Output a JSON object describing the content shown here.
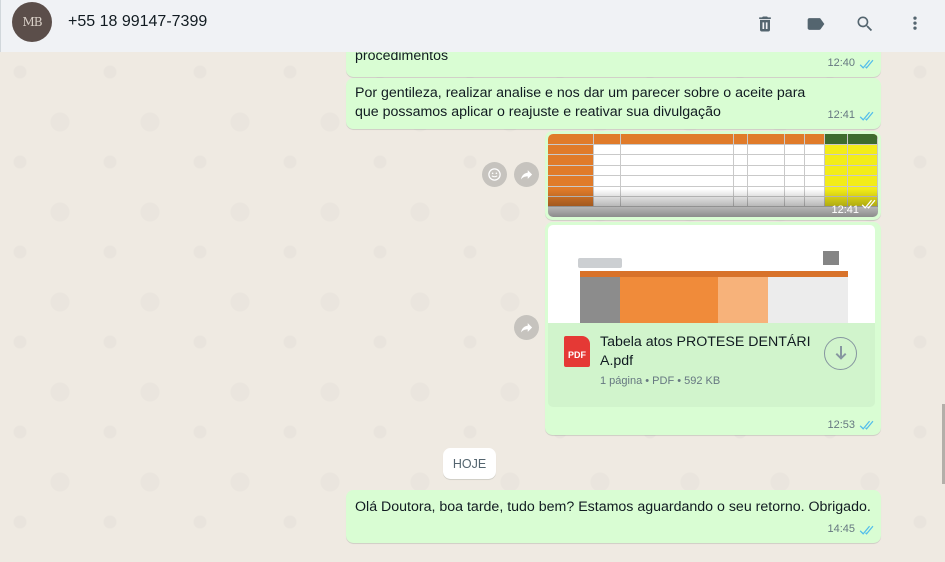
{
  "header": {
    "avatar_initials": "MB",
    "contact": "+55 18 99147-7399",
    "icons": [
      "trash-icon",
      "label-icon",
      "search-icon",
      "menu-dots-icon"
    ]
  },
  "messages": [
    {
      "text": "procedimentos",
      "time": "12:40"
    },
    {
      "text": "Por gentileza, realizar analise e nos dar um parecer sobre o aceite para que possamos aplicar o reajuste e reativar sua divulgação",
      "time": "12:41"
    },
    {
      "type": "image",
      "time": "12:41"
    },
    {
      "type": "document",
      "file_name": "Tabela atos PROTESE DENTÁRIA.pdf",
      "info": "1 página • PDF • 592 KB",
      "icon_label": "PDF",
      "time": "12:53"
    },
    {
      "text": "Olá Doutora, boa tarde, tudo bem? Estamos aguardando o seu retorno. Obrigado.",
      "time": "14:45"
    }
  ],
  "date_chip": "HOJE",
  "colors": {
    "bubble": "#d9fdd3",
    "background": "#efeae2",
    "ticks": "#53bdeb"
  }
}
